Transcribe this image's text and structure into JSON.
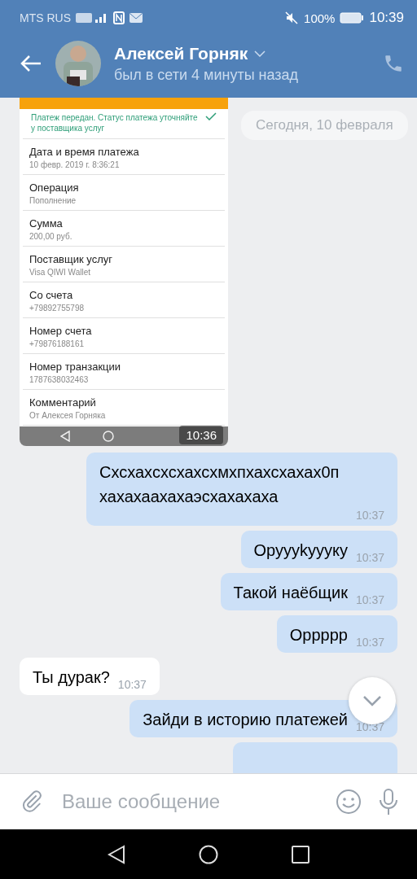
{
  "status_bar": {
    "carrier": "MTS RUS",
    "battery": "100%",
    "time": "10:39"
  },
  "header": {
    "title": "Алексей Горняк",
    "subtitle": "был в сети 4 минуты назад"
  },
  "date_separator": "Сегодня, 10 февраля",
  "attachment": {
    "kind": "screenshot",
    "status_text": "Платеж передан. Статус платежа уточняйте у поставщика услуг",
    "time": "10:36",
    "fields": [
      {
        "label": "Дата и время платежа",
        "value": "10 февр. 2019 г. 8:36:21"
      },
      {
        "label": "Операция",
        "value": "Пополнение"
      },
      {
        "label": "Сумма",
        "value": "200,00 руб."
      },
      {
        "label": "Поставщик услуг",
        "value": "Visa QIWI Wallet"
      },
      {
        "label": "Со счета",
        "value": "+79892755798"
      },
      {
        "label": "Номер счета",
        "value": "+79876188161"
      },
      {
        "label": "Номер транзакции",
        "value": "1787638032463"
      },
      {
        "label": "Комментарий",
        "value": "От Алексея Горняка"
      }
    ]
  },
  "messages": [
    {
      "text": "Схсхахсхсхахсхмхпхахсхахах0п хахахаахахаэсхахахаха",
      "time": "10:37",
      "outgoing": true
    },
    {
      "text": "Оруууkуууку",
      "time": "10:37",
      "outgoing": true
    },
    {
      "text": "Такой наёбщик",
      "time": "10:37",
      "outgoing": true
    },
    {
      "text": "Орpppp",
      "time": "10:37",
      "outgoing": true
    },
    {
      "text": "Ты дурак?",
      "time": "10:37",
      "outgoing": false
    },
    {
      "text": "Зайди в историю платежей",
      "time": "10:37",
      "outgoing": true
    },
    {
      "outgoing": true
    }
  ],
  "composer": {
    "placeholder": "Ваше сообщение"
  }
}
